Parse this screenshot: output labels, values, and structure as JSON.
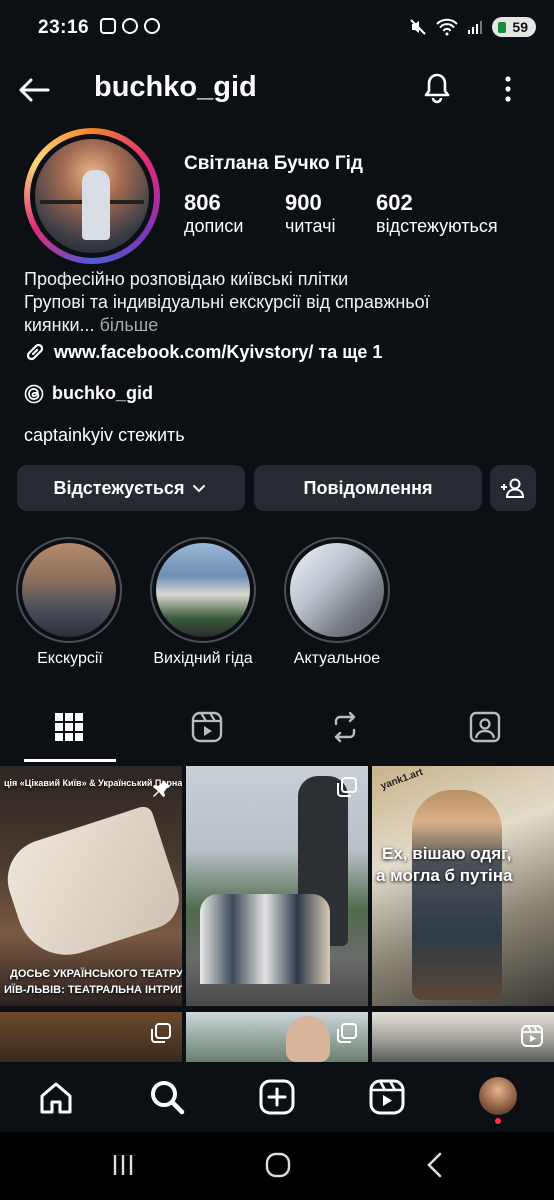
{
  "status": {
    "time": "23:16",
    "battery": "59"
  },
  "header": {
    "username": "buchko_gid"
  },
  "profile": {
    "display_name": "Світлана Бучко Гід",
    "stats": [
      {
        "value": "806",
        "label": "дописи"
      },
      {
        "value": "900",
        "label": "читачі"
      },
      {
        "value": "602",
        "label": "відстежуються"
      }
    ],
    "bio_line1": "Професійно розповідаю київські плітки",
    "bio_line2": "Групові та індивідуальні екскурсії від справжньої",
    "bio_line3": "киянки...",
    "bio_more": "більше",
    "link": "www.facebook.com/Kyivstory/ та ще 1",
    "threads": "buchko_gid",
    "followed_by_user": "captainkyiv",
    "followed_by_suffix": "стежить"
  },
  "buttons": {
    "following": "Відстежується",
    "message": "Повідомлення"
  },
  "highlights": [
    {
      "label": "Екскурсії"
    },
    {
      "label": "Вихідний гіда"
    },
    {
      "label": "Актуальное"
    }
  ],
  "posts": {
    "tile1_caption_top": "ція «Цікавий Київ» & Український Парнас",
    "tile1_caption_bottom1": "ДОСЬЄ УКРАЇНСЬКОГО ТЕАТРУ.",
    "tile1_caption_bottom2": "ИЇВ-ЛЬВІВ: ТЕАТРАЛЬНА ІНТРИГА",
    "tile3_watermark": "yank1.art",
    "tile3_text1": "Ех, вішаю одяг,",
    "tile3_text2": "а могла б путіна"
  }
}
